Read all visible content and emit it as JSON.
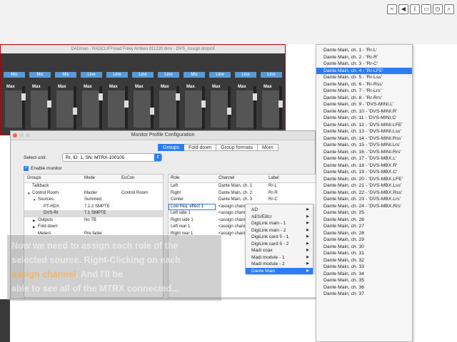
{
  "mixer": {
    "title": "DADman - RADCLIFFroad Foley Ambeo 011220.dms - DVS_Assign.dmprof",
    "strips": [
      {
        "label": "Mic"
      },
      {
        "label": "Mic"
      },
      {
        "label": "Mic"
      },
      {
        "label": "Line"
      },
      {
        "label": "Line"
      },
      {
        "label": "Line"
      },
      {
        "label": "Line"
      },
      {
        "label": "Mic"
      },
      {
        "label": "Line"
      },
      {
        "label": "Line"
      },
      {
        "label": "Line"
      }
    ],
    "max_label": "Max"
  },
  "dialog": {
    "title": "Monitor Profile Configuration",
    "tabs": [
      {
        "label": "Groups",
        "active": true
      },
      {
        "label": "Fold down",
        "active": false
      },
      {
        "label": "Group formats",
        "active": false
      },
      {
        "label": "Mom",
        "active": false
      }
    ],
    "select_unit_label": "Select unit:",
    "select_unit_value": "Rr, ID: 1, SN: MTRX-100105",
    "enable_monitor_label": "Enable monitor",
    "groups_table": {
      "headers": [
        "Groups",
        "Mode",
        "EuCon"
      ],
      "rows": [
        {
          "indent": 0,
          "arrow": "",
          "name": "Talkback",
          "mode": "",
          "eucon": ""
        },
        {
          "indent": 0,
          "arrow": "▼",
          "name": "Control Room",
          "mode": "Master",
          "eucon": "Control Room"
        },
        {
          "indent": 1,
          "arrow": "▼",
          "name": "Sources",
          "mode": "Summed",
          "eucon": ""
        },
        {
          "indent": 2,
          "arrow": "",
          "name": "PT-HDX",
          "mode": "7.1.2 SMPTE",
          "eucon": ""
        },
        {
          "indent": 2,
          "arrow": "",
          "name": "DVS-Rr",
          "mode": "7.1 SMPTE",
          "eucon": "",
          "selected": true
        },
        {
          "indent": 1,
          "arrow": "▶",
          "name": "Outputs",
          "mode": "No TB",
          "eucon": ""
        },
        {
          "indent": 1,
          "arrow": "▶",
          "name": "Fold down",
          "mode": "",
          "eucon": ""
        },
        {
          "indent": 1,
          "arrow": "",
          "name": "Meters",
          "mode": "Pre-fader",
          "eucon": ""
        }
      ]
    },
    "routing_table": {
      "headers": [
        "Role",
        "Channel",
        "Label"
      ],
      "rows": [
        {
          "role": "Left",
          "channel": "Dante Main, ch. 1",
          "label": "Rr-L"
        },
        {
          "role": "Right",
          "channel": "Dante Main, ch. 2",
          "label": "Rr-R"
        },
        {
          "role": "Center",
          "channel": "Dante Main, ch. 3",
          "label": "Rr-C"
        },
        {
          "role": "Low freq. effect 1",
          "channel": "<assign channel>",
          "label": ""
        },
        {
          "role": "Left side 1",
          "channel": "<assign channel>",
          "label": ""
        },
        {
          "role": "Right side 1",
          "channel": "<assign channel>",
          "label": ""
        },
        {
          "role": "Left rear 1",
          "channel": "<assign channel>",
          "label": ""
        },
        {
          "role": "Right rear 1",
          "channel": "<assign channel>",
          "label": ""
        }
      ]
    }
  },
  "caption": {
    "line1": "Now we need to assign each role of the",
    "line2": "selected source. Right-Clicking on each",
    "line3_highlight": "assign channel",
    "line3_rest": ". And I'll be",
    "line4": "able to see all of the MTRX connected..."
  },
  "submenu": {
    "items": [
      {
        "label": "AD",
        "has_sub": true,
        "active": false
      },
      {
        "label": "AES/EBU",
        "has_sub": true,
        "active": false
      },
      {
        "label": "DigiLink main - 1",
        "has_sub": true,
        "active": false
      },
      {
        "label": "DigiLink main - 2",
        "has_sub": true,
        "active": false
      },
      {
        "label": "DigiLink card 5 - 1",
        "has_sub": true,
        "active": false
      },
      {
        "label": "DigiLink card 5 - 2",
        "has_sub": true,
        "active": false
      },
      {
        "label": "Madi coax",
        "has_sub": true,
        "active": false
      },
      {
        "label": "Madi module - 1",
        "has_sub": true,
        "active": false
      },
      {
        "label": "Madi module - 2",
        "has_sub": true,
        "active": false
      },
      {
        "label": "Dante Main",
        "has_sub": true,
        "active": true
      }
    ]
  },
  "channel_list": {
    "items": [
      {
        "label": "Dante Main, ch. 1 - 'Rr-L'",
        "active": false
      },
      {
        "label": "Dante Main, ch. 2 - 'Rr-R'",
        "active": false
      },
      {
        "label": "Dante Main, ch. 3 - 'Rr-C'",
        "active": false
      },
      {
        "label": "Dante Main, ch. 4 - 'Rr-LFE'",
        "active": true
      },
      {
        "label": "Dante Main, ch. 5 - 'Rr-Lss'",
        "active": false
      },
      {
        "label": "Dante Main, ch. 6 - 'Rr-Rss'",
        "active": false
      },
      {
        "label": "Dante Main, ch. 7 - 'Rr-Lrs'",
        "active": false
      },
      {
        "label": "Dante Main, ch. 8 - 'Rr-Rrs'",
        "active": false
      },
      {
        "label": "Dante Main, ch. 9 - 'DVS-MINI.L'",
        "active": false
      },
      {
        "label": "Dante Main, ch. 10 - 'DVS-MINI.R'",
        "active": false
      },
      {
        "label": "Dante Main, ch. 11 - 'DVS-MINI.C'",
        "active": false
      },
      {
        "label": "Dante Main, ch. 12 - 'DVS-MINI.LFE'",
        "active": false
      },
      {
        "label": "Dante Main, ch. 13 - 'DVS-MINI.Lss'",
        "active": false
      },
      {
        "label": "Dante Main, ch. 14 - 'DVS-MINI.Rss'",
        "active": false
      },
      {
        "label": "Dante Main, ch. 15 - 'DVS-MINI.Lrs'",
        "active": false
      },
      {
        "label": "Dante Main, ch. 16 - 'DVS-MINI.Rrs'",
        "active": false
      },
      {
        "label": "Dante Main, ch. 17 - 'DVS-MBX.L'",
        "active": false
      },
      {
        "label": "Dante Main, ch. 18 - 'DVS-MBX.R'",
        "active": false
      },
      {
        "label": "Dante Main, ch. 19 - 'DVS-MBX.C'",
        "active": false
      },
      {
        "label": "Dante Main, ch. 20 - 'DVS-MBX.LFE'",
        "active": false
      },
      {
        "label": "Dante Main, ch. 21 - 'DVS-MBX.Lss'",
        "active": false
      },
      {
        "label": "Dante Main, ch. 22 - 'DVS-MBX.Rss'",
        "active": false
      },
      {
        "label": "Dante Main, ch. 23 - 'DVS-MBX.Lrs'",
        "active": false
      },
      {
        "label": "Dante Main, ch. 24 - 'DVS-MBX.Rrs'",
        "active": false
      },
      {
        "label": "Dante Main, ch. 25",
        "active": false
      },
      {
        "label": "Dante Main, ch. 26",
        "active": false
      },
      {
        "label": "Dante Main, ch. 27",
        "active": false
      },
      {
        "label": "Dante Main, ch. 28",
        "active": false
      },
      {
        "label": "Dante Main, ch. 29",
        "active": false
      },
      {
        "label": "Dante Main, ch. 30",
        "active": false
      },
      {
        "label": "Dante Main, ch. 31",
        "active": false
      },
      {
        "label": "Dante Main, ch. 32",
        "active": false
      },
      {
        "label": "Dante Main, ch. 33",
        "active": false
      },
      {
        "label": "Dante Main, ch. 34",
        "active": false
      },
      {
        "label": "Dante Main, ch. 35",
        "active": false
      },
      {
        "label": "Dante Main, ch. 36",
        "active": false
      },
      {
        "label": "Dante Main, ch. 37",
        "active": false
      }
    ]
  },
  "colors": {
    "accent": "#2c7cf5",
    "strip_button": "#5b9bd5",
    "mixer_bg": "#3a3a3a"
  }
}
